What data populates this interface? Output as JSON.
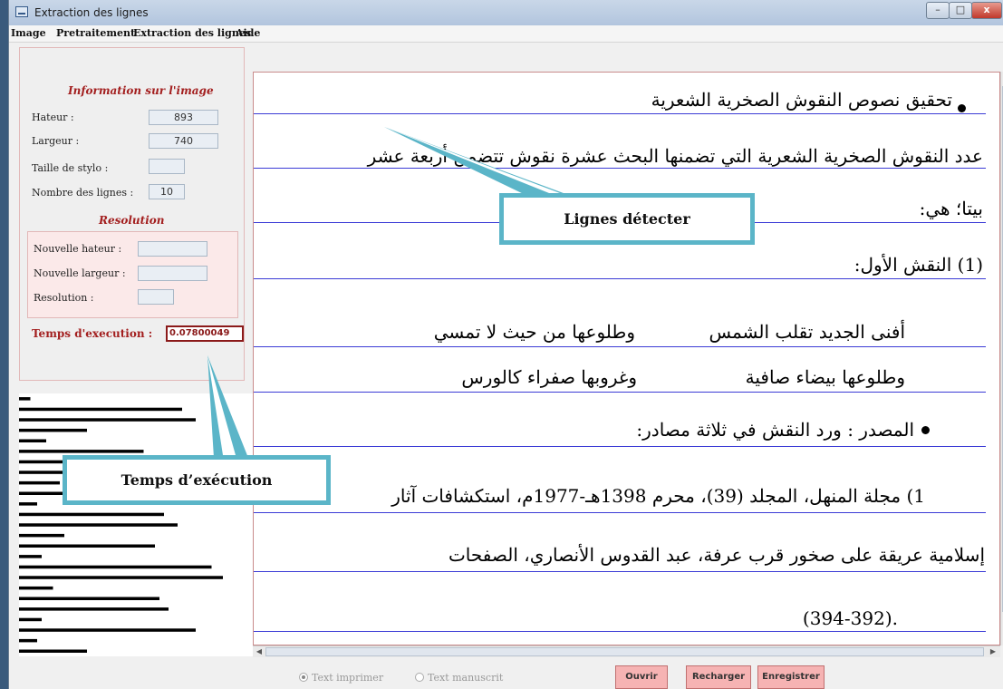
{
  "window": {
    "title": "Extraction des lignes",
    "min_glyph": "–",
    "max_glyph": "□",
    "close_glyph": "x"
  },
  "menu": [
    "Image",
    "Pretraitement",
    "Extraction des lignes",
    "Aide"
  ],
  "info": {
    "title": "Information sur l'image",
    "hauteur_label": "Hateur :",
    "hauteur_value": "893",
    "largeur_label": "Largeur :",
    "largeur_value": "740",
    "stylo_label": "Taille de stylo :",
    "stylo_value": "",
    "lignes_label": "Nombre des lignes :",
    "lignes_value": "10"
  },
  "resolution": {
    "title": "Resolution",
    "new_h_label": "Nouvelle hateur :",
    "new_h_value": "",
    "new_w_label": "Nouvelle largeur :",
    "new_w_value": "",
    "res_label": "Resolution :",
    "res_value": ""
  },
  "time": {
    "label": "Temps d'execution :",
    "value": "0.07800049"
  },
  "document": {
    "lines": [
      "تحقيق نصوص النقوش الصخرية الشعرية",
      "عدد النقوش الصخرية الشعرية التي تضمنها البحث عشرة نقوش تتضمن أربعة عشر",
      "بيتا؛ هي:",
      "(1) النقش الأول:",
      "أفنى الجديد تقلب الشمس",
      "وطلوعها من حيث لا تمسي",
      "وطلوعها بيضاء صافية",
      "وغروبها صفراء كالورس",
      "المصدر : ورد النقش في ثلاثة مصادر:",
      "1) مجلة المنهل، المجلد (39)، محرم 1398هـ-1977م، استكشافات آثار",
      "إسلامية عريقة على صخور قرب عرفة، عبد القدوس الأنصاري، الصفحات",
      ".(394-392)"
    ]
  },
  "callouts": {
    "lines": "Lignes détecter",
    "time": "Temps d’exécution"
  },
  "bottom": {
    "radio_print": "Text imprimer",
    "radio_hand": "Text manuscrit",
    "btn_open": "Ouvrir",
    "btn_reload": "Recharger",
    "btn_save": "Enregistrer"
  },
  "histogram": {
    "profile": [
      0.05,
      0.72,
      0.78,
      0.3,
      0.12,
      0.55,
      0.2,
      0.62,
      0.18,
      0.5,
      0.08,
      0.64,
      0.7,
      0.2,
      0.6,
      0.1,
      0.85,
      0.9,
      0.15,
      0.62,
      0.66,
      0.1,
      0.78,
      0.08,
      0.3
    ]
  },
  "colors": {
    "accent_red": "#a31f1f",
    "line_blue": "#3b3bd6",
    "callout_border": "#5bb5c8",
    "button_pink": "#f6b3b3"
  }
}
